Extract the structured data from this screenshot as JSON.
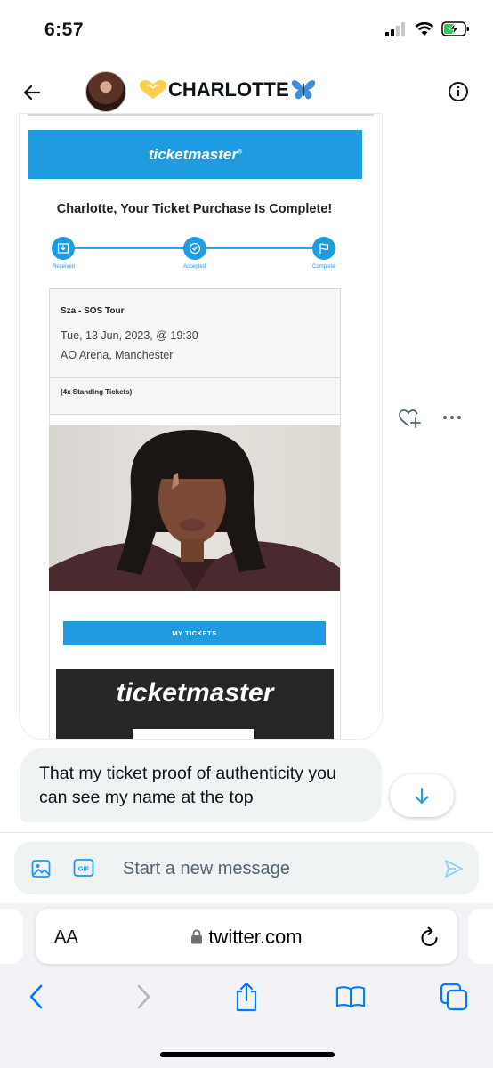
{
  "status_bar": {
    "time": "6:57"
  },
  "header": {
    "name": "CHARLOTTE"
  },
  "email": {
    "brand": "ticketmaster",
    "title": "Charlotte, Your Ticket Purchase Is Complete!",
    "steps": [
      "Received",
      "Accepted",
      "Complete"
    ],
    "event_name": "Sza - SOS Tour",
    "event_date": "Tue, 13 Jun, 2023, @ 19:30",
    "venue": "AO Arena, Manchester",
    "ticket_count": "(4x Standing Tickets)",
    "button_label": "MY  TICKETS",
    "footer_brand": "ticketmaster"
  },
  "message": {
    "text": "That my ticket proof of authenticity you can see my name at the top"
  },
  "composer": {
    "placeholder": "Start a new message",
    "gif_label": "GIF"
  },
  "browser": {
    "aa_label": "AA",
    "url": "twitter.com"
  },
  "colors": {
    "accent": "#1d9bf0",
    "ticketmaster_blue": "#1f9be2",
    "bubble_bg": "#eff3f4"
  }
}
